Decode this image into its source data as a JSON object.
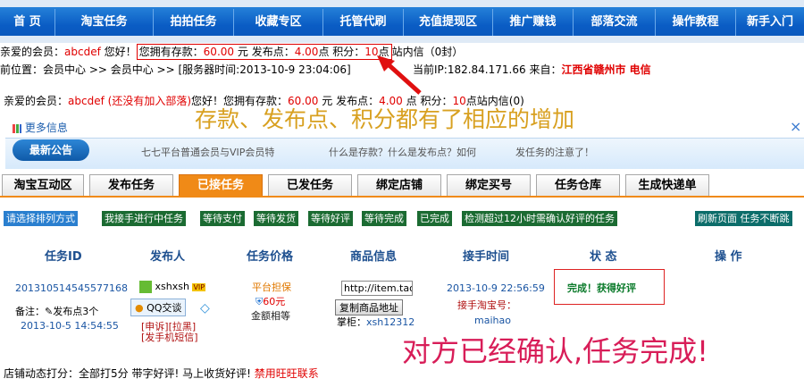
{
  "topnav": {
    "items": [
      "首  页",
      "淘宝任务",
      "拍拍任务",
      "收藏专区",
      "托管代刷",
      "充值提现区",
      "推广赚钱",
      "部落交流",
      "操作教程",
      "新手入门"
    ]
  },
  "account_line": {
    "prefix": "亲爱的会员：",
    "username": "abcdef",
    "greeting": "您好！",
    "deposit_label": "您拥有存款：",
    "deposit_value": "60.00",
    "yuan": "元",
    "points_label": "发布点：",
    "points_value": "4.00",
    "points_unit": "点",
    "score_label": "积分：",
    "score_value": "10",
    "score_unit": "点",
    "inbox": "站内信（0封）"
  },
  "location_line": {
    "text": "前位置：会员中心 >> 会员中心 >> [服务器时间:2013-10-9 23:04:06]"
  },
  "ip_line": {
    "ip_label": "当前IP:182.84.171.66",
    "from_label": "来自：",
    "from_value": "江西省赣州市 电信"
  },
  "account_line2": {
    "prefix": "亲爱的会员：",
    "username": "abcdef",
    "tribe": "(还没有加入部落)",
    "greeting": "您好！",
    "deposit_label": "您拥有存款：",
    "deposit_value": "60.00",
    "yuan": "元",
    "points_label": "发布点：",
    "points_value": "4.00",
    "points_unit": "点",
    "score_label": "积分：",
    "score_value": "10",
    "score_unit": "点",
    "inbox": "站内信(0)"
  },
  "annotations": {
    "top": "存款、发布点、积分都有了相应的增加",
    "bottom": "对方已经确认,任务完成!"
  },
  "notice": {
    "more_info": "更多信息",
    "latest": "最新公告",
    "items": [
      "七七平台普通会员与VIP会员特",
      "什么是存款？什么是发布点？如何",
      "发任务的注意了！"
    ],
    "close": "×"
  },
  "tabs": [
    "淘宝互动区",
    "发布任务",
    "已接任务",
    "已发任务",
    "绑定店铺",
    "绑定买号",
    "任务仓库",
    "生成快递单"
  ],
  "active_tab": "已接任务",
  "filters": {
    "sort": "请选择排列方式",
    "items": [
      "我接手进行中任务",
      "等待支付",
      "等待发货",
      "等待好评",
      "等待完成",
      "已完成",
      "检测超过12小时需确认好评的任务"
    ],
    "refresh": "刷新页面 任务不断跳"
  },
  "table": {
    "headers": [
      "任务ID",
      "发布人",
      "任务价格",
      "商品信息",
      "接手时间",
      "状  态",
      "操  作"
    ],
    "row": {
      "task_id": "201310514545577168",
      "note_label": "备注：",
      "note_value": "发布点3个",
      "task_time": "2013-10-5 14:54:55",
      "publisher": "xshxsh",
      "publisher_badge": "VIP",
      "qq": "QQ交谈",
      "appeal": "[申诉]",
      "blacklist": "[拉黑]",
      "sms": "[发手机短信]",
      "guarantee": "平台担保",
      "price": "60元",
      "amount_note": "金额相等",
      "url_value": "http://item.taol",
      "copy_button": "复制商品地址",
      "shopkeeper_label": "掌柜：",
      "shopkeeper": "xsh12312",
      "accept_time": "2013-10-9 22:56:59",
      "buyer_label": "接手淘宝号：",
      "buyer": "maihao",
      "status": "完成！获得好评"
    }
  },
  "footer": {
    "text_a": "店铺动态打分：全部打5分 带字好评! 马上收货好评! ",
    "text_b": "禁用旺旺联系"
  },
  "colors": {
    "nav_blue": "#0a5cc4",
    "accent_orange": "#f08a17",
    "alert_red": "#e00000",
    "annot_gold": "#d8a020",
    "annot_pink": "#d81d58"
  }
}
